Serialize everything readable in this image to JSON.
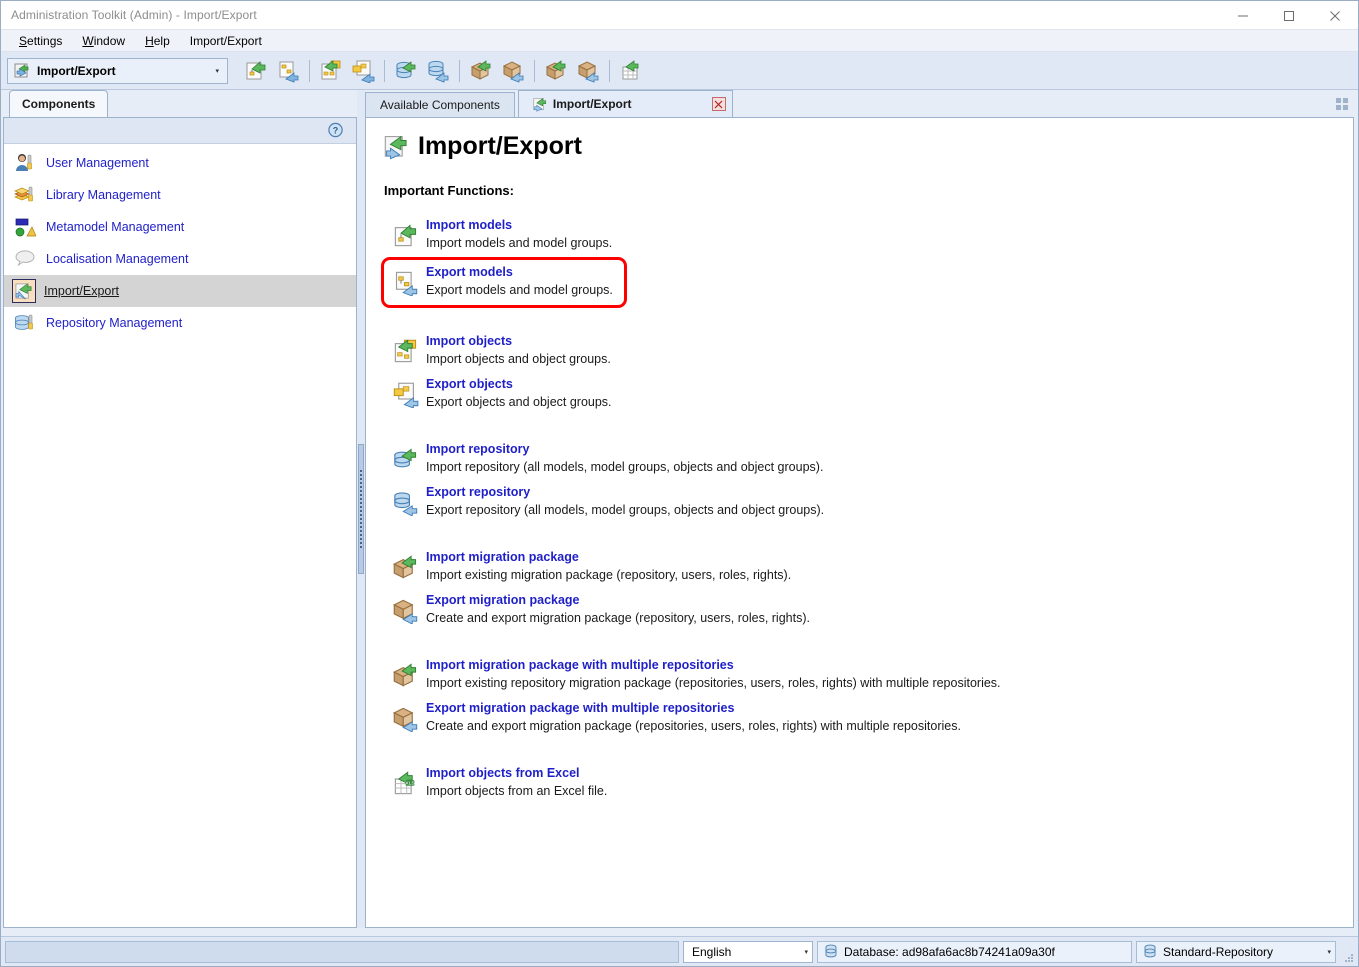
{
  "window": {
    "title": "Administration Toolkit (Admin) - Import/Export",
    "minimize_label": "—",
    "maximize_label": "□",
    "close_label": "✕"
  },
  "menubar": {
    "items": [
      {
        "mnemonic": "S",
        "rest": "ettings"
      },
      {
        "mnemonic": "W",
        "rest": "indow"
      },
      {
        "mnemonic": "H",
        "rest": "elp"
      },
      {
        "mnemonic": "",
        "rest": "Import/Export"
      }
    ]
  },
  "toolbar": {
    "component_combo": {
      "value": "Import/Export",
      "arrow": "▾"
    },
    "buttons": [
      {
        "name": "import-models-toolbar-button",
        "tooltip": "Import models"
      },
      {
        "name": "export-models-toolbar-button",
        "tooltip": "Export models"
      },
      {
        "name": "import-objects-toolbar-button",
        "tooltip": "Import objects"
      },
      {
        "name": "export-objects-toolbar-button",
        "tooltip": "Export objects"
      },
      {
        "name": "import-repository-toolbar-button",
        "tooltip": "Import repository"
      },
      {
        "name": "export-repository-toolbar-button",
        "tooltip": "Export repository"
      },
      {
        "name": "import-migration-package-toolbar-button",
        "tooltip": "Import migration package"
      },
      {
        "name": "export-migration-package-toolbar-button",
        "tooltip": "Export migration package"
      },
      {
        "name": "import-migration-package-multi-toolbar-button",
        "tooltip": "Import migration package with multiple repositories"
      },
      {
        "name": "export-migration-package-multi-toolbar-button",
        "tooltip": "Export migration package with multiple repositories"
      },
      {
        "name": "import-objects-from-excel-toolbar-button",
        "tooltip": "Import objects from Excel"
      }
    ]
  },
  "sidebar": {
    "tab_label": "Components",
    "help_icon": "help-icon",
    "items": [
      {
        "label": "User Management",
        "icon": "user-management-icon",
        "selected": false
      },
      {
        "label": "Library Management",
        "icon": "library-management-icon",
        "selected": false
      },
      {
        "label": "Metamodel Management",
        "icon": "metamodel-management-icon",
        "selected": false
      },
      {
        "label": "Localisation Management",
        "icon": "localisation-management-icon",
        "selected": false
      },
      {
        "label": "Import/Export",
        "icon": "import-export-icon",
        "selected": true
      },
      {
        "label": "Repository Management",
        "icon": "repository-management-icon",
        "selected": false
      }
    ]
  },
  "main": {
    "tabs": [
      {
        "label": "Available Components",
        "active": false,
        "closable": false
      },
      {
        "label": "Import/Export",
        "active": true,
        "closable": true,
        "close_label": "☒"
      }
    ],
    "grid_button": "tile-windows-icon",
    "page_title": "Import/Export",
    "section_title": "Important Functions:",
    "groups": [
      {
        "functions": [
          {
            "link": "Import models",
            "desc": "Import models and model groups.",
            "icon": "import-models-icon",
            "highlighted": false
          },
          {
            "link": "Export models",
            "desc": "Export models and model groups.",
            "icon": "export-models-icon",
            "highlighted": true
          }
        ]
      },
      {
        "functions": [
          {
            "link": "Import objects",
            "desc": "Import objects and object groups.",
            "icon": "import-objects-icon",
            "highlighted": false
          },
          {
            "link": "Export objects",
            "desc": "Export objects and object groups.",
            "icon": "export-objects-icon",
            "highlighted": false
          }
        ]
      },
      {
        "functions": [
          {
            "link": "Import repository",
            "desc": "Import repository (all models, model groups, objects and object groups).",
            "icon": "import-repository-icon",
            "highlighted": false
          },
          {
            "link": "Export repository",
            "desc": "Export repository (all models, model groups, objects and object groups).",
            "icon": "export-repository-icon",
            "highlighted": false
          }
        ]
      },
      {
        "functions": [
          {
            "link": "Import migration package",
            "desc": "Import existing migration package (repository, users, roles, rights).",
            "icon": "import-migration-package-icon",
            "highlighted": false
          },
          {
            "link": "Export migration package",
            "desc": "Create and export migration package (repository, users, roles, rights).",
            "icon": "export-migration-package-icon",
            "highlighted": false
          }
        ]
      },
      {
        "functions": [
          {
            "link": "Import migration package with multiple repositories",
            "desc": "Import existing repository migration package (repositories, users, roles, rights) with multiple repositories.",
            "icon": "import-migration-package-multi-icon",
            "highlighted": false
          },
          {
            "link": "Export migration package with multiple repositories",
            "desc": "Create and export migration package (repositories, users, roles, rights) with multiple repositories.",
            "icon": "export-migration-package-multi-icon",
            "highlighted": false
          }
        ]
      },
      {
        "functions": [
          {
            "link": "Import objects from Excel",
            "desc": "Import objects from an Excel file.",
            "icon": "import-objects-from-excel-icon",
            "highlighted": false
          }
        ]
      }
    ]
  },
  "statusbar": {
    "language": {
      "value": "English",
      "arrow": "▾"
    },
    "database": {
      "label": "Database: ad98afa6ac8b74241a09a30f",
      "icon": "database-icon"
    },
    "repository": {
      "value": "Standard-Repository",
      "icon": "database-icon",
      "arrow": "▾"
    }
  },
  "colors": {
    "link": "#1f1fc8",
    "highlight_border": "#fe0000",
    "toolbar_bg": "#dfe8f4",
    "selection_bg": "#d4d4d4",
    "title_text": "#8d8d8d"
  }
}
